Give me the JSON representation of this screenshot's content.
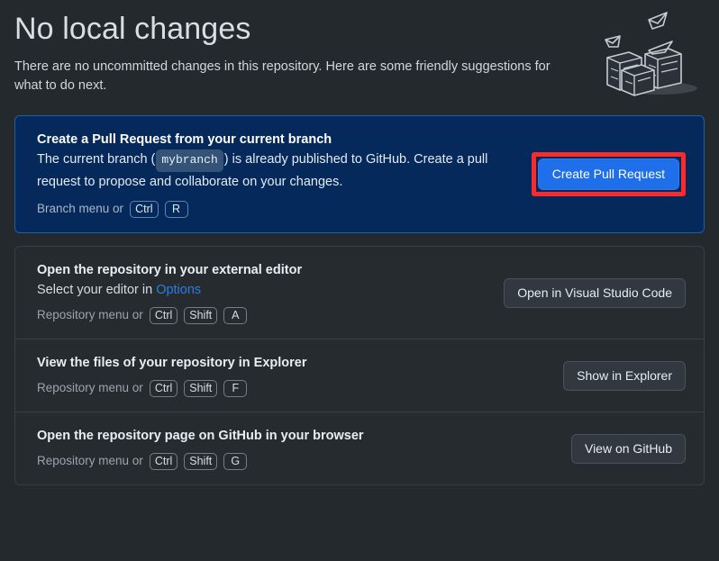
{
  "header": {
    "title": "No local changes",
    "subtitle": "There are no uncommitted changes in this repository. Here are some friendly suggestions for what to do next.",
    "illustration": "paper-stack-illustration"
  },
  "suggestions": [
    {
      "id": "create-pull-request",
      "title": "Create a Pull Request from your current branch",
      "desc_before": "The current branch (",
      "branch": "mybranch",
      "desc_after": ") is already published to GitHub. Create a pull request to propose and collaborate on your changes.",
      "hint_label": "Branch menu or",
      "keys": [
        "Ctrl",
        "R"
      ],
      "button": "Create Pull Request",
      "highlighted": true
    },
    {
      "id": "open-external-editor",
      "title": "Open the repository in your external editor",
      "desc_before": "Select your editor in ",
      "link": "Options",
      "hint_label": "Repository menu or",
      "keys": [
        "Ctrl",
        "Shift",
        "A"
      ],
      "button": "Open in Visual Studio Code"
    },
    {
      "id": "show-in-explorer",
      "title": "View the files of your repository in Explorer",
      "hint_label": "Repository menu or",
      "keys": [
        "Ctrl",
        "Shift",
        "F"
      ],
      "button": "Show in Explorer"
    },
    {
      "id": "view-on-github",
      "title": "Open the repository page on GitHub in your browser",
      "hint_label": "Repository menu or",
      "keys": [
        "Ctrl",
        "Shift",
        "G"
      ],
      "button": "View on GitHub"
    }
  ],
  "colors": {
    "page_background": "#24292e",
    "primary_card_background": "#04295a",
    "primary_card_border": "#1b5fa8",
    "secondary_card_background": "#262b30",
    "accent_button": "#1f6feb",
    "link": "#2f7ce0",
    "highlight": "#fc2b2b"
  }
}
